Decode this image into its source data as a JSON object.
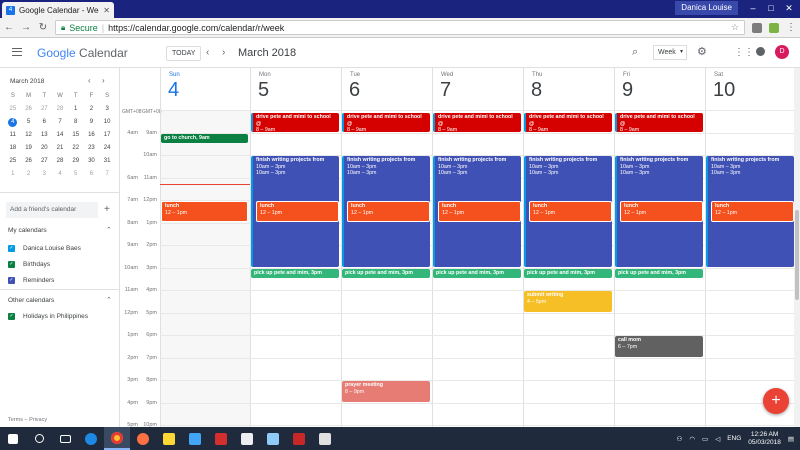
{
  "browser": {
    "tab_title": "Google Calendar - Week",
    "tab_close": "✕",
    "tab_favicon": "4",
    "user_badge": "Danica Louise",
    "secure_label": "Secure",
    "url": "https://calendar.google.com/calendar/r/week"
  },
  "header": {
    "logo_google": "Google",
    "logo_calendar": "Calendar",
    "today_button": "TODAY",
    "current_month": "March 2018",
    "view_selector": "Week",
    "avatar_initial": "D"
  },
  "mini_calendar": {
    "title": "March 2018",
    "weekdays": [
      "S",
      "M",
      "T",
      "W",
      "T",
      "F",
      "S"
    ],
    "days": [
      [
        "25",
        "26",
        "27",
        "28",
        "1",
        "2",
        "3"
      ],
      [
        "4",
        "5",
        "6",
        "7",
        "8",
        "9",
        "10"
      ],
      [
        "11",
        "12",
        "13",
        "14",
        "15",
        "16",
        "17"
      ],
      [
        "18",
        "19",
        "20",
        "21",
        "22",
        "23",
        "24"
      ],
      [
        "25",
        "26",
        "27",
        "28",
        "29",
        "30",
        "31"
      ],
      [
        "1",
        "2",
        "3",
        "4",
        "5",
        "6",
        "7"
      ]
    ],
    "selected": "4"
  },
  "sidebar": {
    "add_friend_placeholder": "Add a friend's calendar",
    "my_calendars_title": "My calendars",
    "my_calendars": [
      {
        "label": "Danica Louise Baes",
        "color": "#039be5"
      },
      {
        "label": "Birthdays",
        "color": "#0b8043"
      },
      {
        "label": "Reminders",
        "color": "#3f51b5"
      }
    ],
    "other_calendars_title": "Other calendars",
    "other_calendars": [
      {
        "label": "Holidays in Philippines",
        "color": "#0b8043"
      }
    ],
    "terms": "Terms – Privacy"
  },
  "week": {
    "timezones": [
      "GMT+08",
      "GMT+08"
    ],
    "days": [
      {
        "name": "Sun",
        "num": "4",
        "today": true
      },
      {
        "name": "Mon",
        "num": "5"
      },
      {
        "name": "Tue",
        "num": "6"
      },
      {
        "name": "Wed",
        "num": "7"
      },
      {
        "name": "Thu",
        "num": "8"
      },
      {
        "name": "Fri",
        "num": "9"
      },
      {
        "name": "Sat",
        "num": "10"
      }
    ],
    "times_a": [
      "",
      "4am",
      "",
      "6am",
      "7am",
      "8am",
      "9am",
      "10am",
      "11am",
      "12pm",
      "1pm",
      "2pm",
      "3pm",
      "4pm",
      "5pm"
    ],
    "times_b": [
      "",
      "9am",
      "10am",
      "11am",
      "12pm",
      "1pm",
      "2pm",
      "3pm",
      "4pm",
      "5pm",
      "6pm",
      "7pm",
      "8pm",
      "9pm",
      "10pm"
    ],
    "events": {
      "church": {
        "title": "go to church, 9am"
      },
      "drive": {
        "title": "drive pete and mimi to school @",
        "time": "8 – 9am"
      },
      "writing": {
        "title": "finish writing projects from",
        "line2": "10am – 3pm",
        "line3": "10am – 3pm"
      },
      "lunch": {
        "title": "lunch",
        "time": "12 – 1pm"
      },
      "pickup": {
        "title": "pick up pete and mim, 3pm"
      },
      "submit": {
        "title": "submit writing",
        "time": "4 – 5pm"
      },
      "callmom": {
        "title": "call mom",
        "time": "6 – 7pm"
      },
      "prayer": {
        "title": "prayer meeting",
        "time": "8 – 9pm"
      }
    }
  },
  "taskbar": {
    "lang": "ENG",
    "time": "12:26 AM",
    "date": "05/03/2018"
  }
}
